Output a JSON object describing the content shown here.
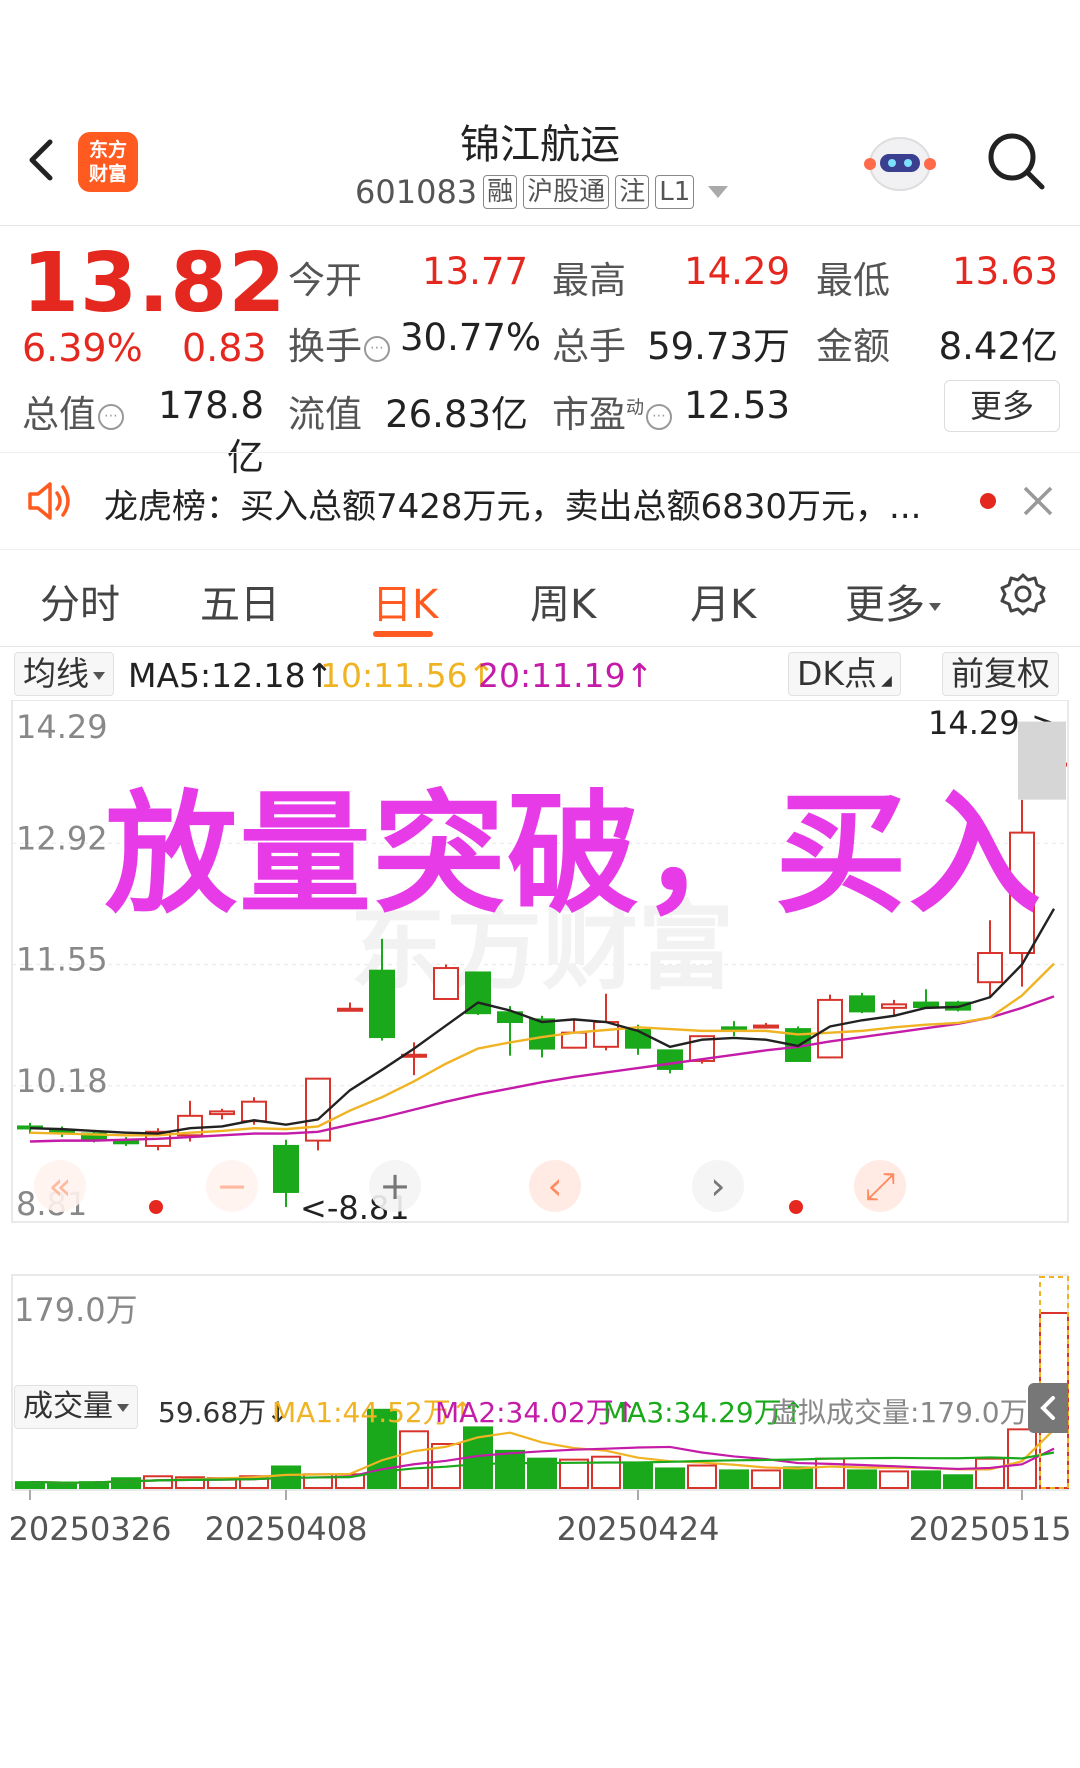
{
  "header": {
    "stock_name": "锦江航运",
    "stock_code": "601083",
    "tags": [
      "融",
      "沪股通",
      "注",
      "L1"
    ],
    "logo_text": [
      "东方",
      "财富"
    ]
  },
  "quote": {
    "price": "13.82",
    "change_pct": "6.39%",
    "change": "0.83",
    "open_label": "今开",
    "open": "13.77",
    "high_label": "最高",
    "high": "14.29",
    "low_label": "最低",
    "low": "13.63",
    "turnover_label": "换手",
    "turnover": "30.77%",
    "volume_label": "总手",
    "volume": "59.73万",
    "amount_label": "金额",
    "amount": "8.42亿",
    "mktcap_label": "总值",
    "mktcap": "178.8亿",
    "float_label": "流值",
    "float": "26.83亿",
    "pe_label": "市盈",
    "pe_sup": "动",
    "pe": "12.53",
    "more_label": "更多"
  },
  "notice": {
    "text": "龙虎榜：买入总额7428万元，卖出总额6830万元，..."
  },
  "tabs": [
    {
      "label": "分时"
    },
    {
      "label": "五日"
    },
    {
      "label": "日K"
    },
    {
      "label": "周K"
    },
    {
      "label": "月K"
    },
    {
      "label": "更多"
    }
  ],
  "ma_bar": {
    "dropdown": "均线",
    "ma5": "MA5:12.18↑",
    "ma10": "10:11.56↑",
    "ma20": "20:11.19↑",
    "dk": "DK点",
    "adjust": "前复权"
  },
  "overlay": "放量突破，买入",
  "watermark": "东方财富",
  "price_axis": [
    "14.29",
    "12.92",
    "11.55",
    "10.18",
    "8.81"
  ],
  "high_marker": "14.29->",
  "low_marker": "<-8.81",
  "volume_bar": {
    "dropdown": "成交量",
    "vol": "59.68万↓",
    "ma1": "MA1:44.52万↑",
    "ma2": "MA2:34.02万↑",
    "ma3": "MA3:34.29万↑",
    "virtual": "虚拟成交量:179.0万",
    "axis_max": "179.0万"
  },
  "dates": [
    "20250326",
    "20250408",
    "20250424",
    "20250515"
  ],
  "colors": {
    "up": "#d9342b",
    "down": "#1aa91a",
    "ma5": "#222222",
    "ma10": "#f0b323",
    "ma20": "#c41ba8",
    "accent": "#ff5a1f"
  },
  "chart_data": {
    "type": "candlestick",
    "ylim": [
      8.81,
      14.29
    ],
    "candles": [
      {
        "o": 9.72,
        "h": 9.76,
        "l": 9.64,
        "c": 9.7
      },
      {
        "o": 9.68,
        "h": 9.72,
        "l": 9.6,
        "c": 9.66
      },
      {
        "o": 9.64,
        "h": 9.68,
        "l": 9.54,
        "c": 9.58
      },
      {
        "o": 9.56,
        "h": 9.6,
        "l": 9.5,
        "c": 9.53
      },
      {
        "o": 9.5,
        "h": 9.7,
        "l": 9.45,
        "c": 9.66
      },
      {
        "o": 9.62,
        "h": 10.01,
        "l": 9.55,
        "c": 9.84
      },
      {
        "o": 9.86,
        "h": 9.92,
        "l": 9.8,
        "c": 9.89
      },
      {
        "o": 9.78,
        "h": 10.05,
        "l": 9.74,
        "c": 10.0
      },
      {
        "o": 9.5,
        "h": 9.57,
        "l": 8.81,
        "c": 8.98
      },
      {
        "o": 9.56,
        "h": 10.26,
        "l": 9.45,
        "c": 10.26
      },
      {
        "o": 11.05,
        "h": 11.12,
        "l": 11.04,
        "c": 11.05
      },
      {
        "o": 11.48,
        "h": 11.84,
        "l": 10.69,
        "c": 10.73
      },
      {
        "o": 10.52,
        "h": 10.67,
        "l": 10.3,
        "c": 10.53
      },
      {
        "o": 11.16,
        "h": 11.55,
        "l": 11.16,
        "c": 11.51
      },
      {
        "o": 11.46,
        "h": 11.46,
        "l": 10.98,
        "c": 11.0
      },
      {
        "o": 11.01,
        "h": 11.08,
        "l": 10.52,
        "c": 10.9
      },
      {
        "o": 10.93,
        "h": 10.97,
        "l": 10.5,
        "c": 10.6
      },
      {
        "o": 10.61,
        "h": 10.93,
        "l": 10.6,
        "c": 10.78
      },
      {
        "o": 10.62,
        "h": 11.22,
        "l": 10.58,
        "c": 10.9
      },
      {
        "o": 10.81,
        "h": 10.87,
        "l": 10.53,
        "c": 10.61
      },
      {
        "o": 10.58,
        "h": 10.58,
        "l": 10.32,
        "c": 10.37
      },
      {
        "o": 10.46,
        "h": 10.74,
        "l": 10.43,
        "c": 10.74
      },
      {
        "o": 10.84,
        "h": 10.91,
        "l": 10.74,
        "c": 10.82
      },
      {
        "o": 10.85,
        "h": 10.89,
        "l": 10.83,
        "c": 10.86
      },
      {
        "o": 10.82,
        "h": 10.85,
        "l": 10.46,
        "c": 10.46
      },
      {
        "o": 10.5,
        "h": 11.21,
        "l": 10.49,
        "c": 11.15
      },
      {
        "o": 11.19,
        "h": 11.23,
        "l": 11.0,
        "c": 11.02
      },
      {
        "o": 11.06,
        "h": 11.15,
        "l": 10.96,
        "c": 11.1
      },
      {
        "o": 11.12,
        "h": 11.27,
        "l": 11.06,
        "c": 11.07
      },
      {
        "o": 11.12,
        "h": 11.14,
        "l": 11.02,
        "c": 11.04
      },
      {
        "o": 11.35,
        "h": 12.05,
        "l": 11.19,
        "c": 11.68
      },
      {
        "o": 11.68,
        "h": 13.41,
        "l": 11.3,
        "c": 13.04
      },
      {
        "o": 13.82,
        "h": 14.29,
        "l": 13.63,
        "c": 13.82
      }
    ],
    "ma5": [
      9.7,
      9.69,
      9.67,
      9.65,
      9.64,
      9.7,
      9.72,
      9.79,
      9.74,
      9.8,
      10.13,
      10.36,
      10.6,
      10.86,
      11.12,
      11.03,
      10.9,
      10.93,
      10.9,
      10.8,
      10.62,
      10.7,
      10.72,
      10.7,
      10.63,
      10.85,
      10.92,
      10.97,
      11.06,
      11.07,
      11.18,
      11.55,
      12.18
    ],
    "ma10": [
      9.65,
      9.64,
      9.63,
      9.62,
      9.62,
      9.65,
      9.67,
      9.7,
      9.69,
      9.72,
      9.9,
      10.05,
      10.23,
      10.43,
      10.6,
      10.67,
      10.73,
      10.78,
      10.81,
      10.84,
      10.82,
      10.8,
      10.8,
      10.8,
      10.76,
      10.78,
      10.8,
      10.84,
      10.87,
      10.89,
      10.95,
      11.2,
      11.56
    ],
    "ma20": [
      9.55,
      9.56,
      9.56,
      9.57,
      9.58,
      9.6,
      9.62,
      9.64,
      9.64,
      9.66,
      9.74,
      9.82,
      9.91,
      10.0,
      10.08,
      10.15,
      10.22,
      10.28,
      10.33,
      10.38,
      10.43,
      10.48,
      10.53,
      10.58,
      10.62,
      10.68,
      10.73,
      10.78,
      10.83,
      10.88,
      10.95,
      11.06,
      11.19
    ],
    "volume": [
      6,
      5,
      6,
      10,
      12,
      11,
      10,
      12,
      22,
      14,
      14,
      80,
      58,
      45,
      62,
      38,
      30,
      29,
      32,
      26,
      20,
      23,
      18,
      18,
      21,
      30,
      18,
      17,
      17,
      13,
      30,
      60,
      179
    ],
    "vol_ylim": [
      0,
      179
    ]
  }
}
